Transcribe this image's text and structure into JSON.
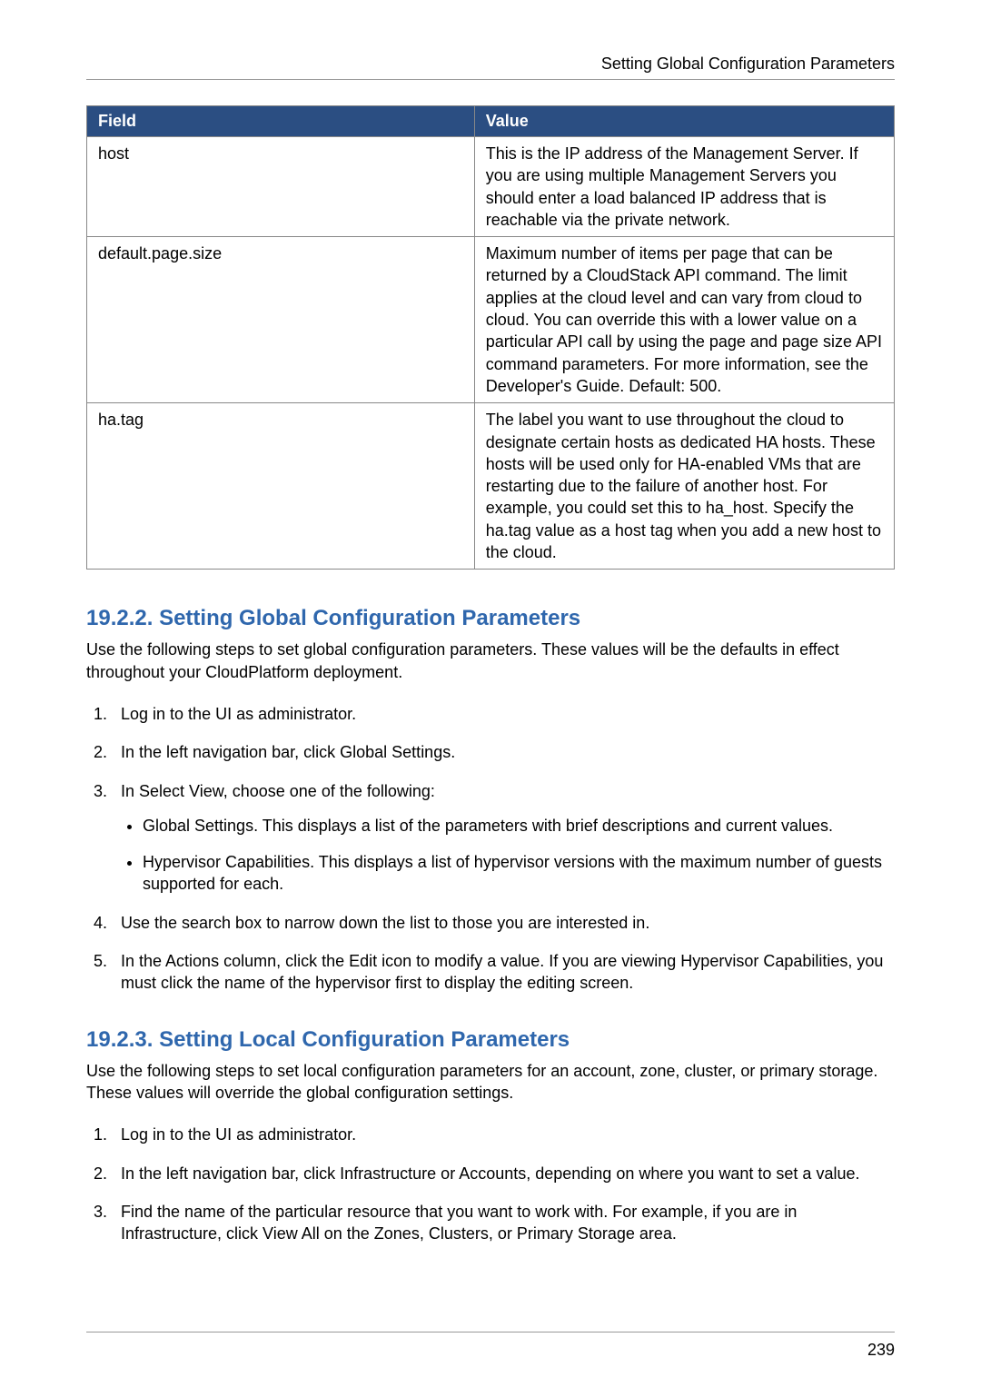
{
  "runningHead": "Setting Global Configuration Parameters",
  "table": {
    "headers": {
      "field": "Field",
      "value": "Value"
    },
    "rows": [
      {
        "field": "host",
        "value": "This is the IP address of the Management Server. If you are using multiple Management Servers you should enter a load balanced IP address that is reachable via the private network."
      },
      {
        "field": "default.page.size",
        "value": "Maximum number of items per page that can be returned by a CloudStack API command. The limit applies at the cloud level and can vary from cloud to cloud. You can override this with a lower value on a particular API call by using the page and page size API command parameters. For more information, see the Developer's Guide. Default: 500."
      },
      {
        "field": "ha.tag",
        "value": "The label you want to use throughout the cloud to designate certain hosts as dedicated HA hosts. These hosts will be used only for HA-enabled VMs that are restarting due to the failure of another host. For example, you could set this to ha_host. Specify the ha.tag value as a host tag when you add a new host to the cloud."
      }
    ]
  },
  "section1": {
    "title": "19.2.2. Setting Global Configuration Parameters",
    "intro": "Use the following steps to set global configuration parameters. These values will be the defaults in effect throughout your CloudPlatform deployment.",
    "steps": [
      "Log in to the UI as administrator.",
      "In the left navigation bar, click Global Settings.",
      "In Select View, choose one of the following:",
      "Use the search box to narrow down the list to those you are interested in.",
      "In the Actions column, click the Edit icon to modify a value. If you are viewing Hypervisor Capabilities, you must click the name of the hypervisor first to display the editing screen."
    ],
    "step3bullets": [
      "Global Settings. This displays a list of the parameters with brief descriptions and current values.",
      "Hypervisor Capabilities. This displays a list of hypervisor versions with the maximum number of guests supported for each."
    ]
  },
  "section2": {
    "title": "19.2.3. Setting Local Configuration Parameters",
    "intro": "Use the following steps to set local configuration parameters for an account, zone, cluster, or primary storage. These values will override the global configuration settings.",
    "steps": [
      "Log in to the UI as administrator.",
      "In the left navigation bar, click Infrastructure or Accounts, depending on where you want to set a value.",
      "Find the name of the particular resource that you want to work with. For example, if you are in Infrastructure, click View All on the Zones, Clusters, or Primary Storage area."
    ]
  },
  "pageNumber": "239"
}
